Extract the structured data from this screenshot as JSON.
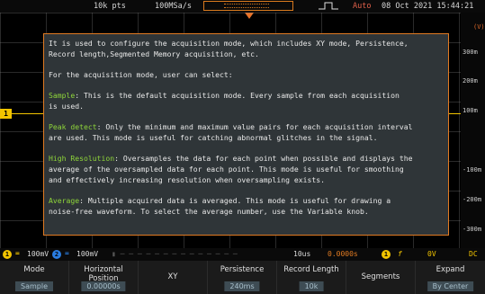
{
  "top_bar": {
    "record_length": "10k pts",
    "sample_rate": "100MSa/s",
    "trigger_mode": "Auto",
    "datetime": "08 Oct 2021 15:44:21"
  },
  "scale": {
    "unit": "(V)",
    "ticks": [
      "300m",
      "200m",
      "100m",
      "-100m",
      "-200m",
      "-300m"
    ]
  },
  "channel_marker": "1",
  "help": {
    "intro": "It is used to configure the acquisition mode, which includes XY mode, Persistence,\nRecord length,Segmented Memory acquisition, etc.",
    "select_line": "For the acquisition mode, user can select:",
    "items": [
      {
        "name": "Sample",
        "text": ": This is the default acquisition mode. Every sample from each acquisition\nis used."
      },
      {
        "name": "Peak detect",
        "text": ": Only the minimum and maximum value pairs for each acquisition interval\nare used. This mode is useful for catching abnormal glitches in the signal."
      },
      {
        "name": "High Resolution",
        "text": ": Oversamples the data for each point when possible and displays the\naverage of the oversampled data for each point. This mode is useful for smoothing\nand effectively increasing resolution when oversampling exists."
      },
      {
        "name": "Average",
        "text": ": Multiple acquired data is averaged. This mode is useful for drawing a\nnoise-free waveform. To select the average number, use the Variable knob."
      }
    ]
  },
  "readout": {
    "ch1_label": "1",
    "ch1_value": "100mV",
    "ch2_label": "2",
    "ch2_value": "100mV",
    "timebase": "10us",
    "position": "0.0000s",
    "trigger_source": "1",
    "trigger_slope": "f",
    "trigger_level": "0V",
    "coupling": "DC"
  },
  "softkeys": [
    {
      "label": "Mode",
      "value": "Sample"
    },
    {
      "label": "Horizontal\nPosition",
      "value": "0.00000s"
    },
    {
      "label": "XY",
      "value": ""
    },
    {
      "label": "Persistence",
      "value": "240ms"
    },
    {
      "label": "Record Length",
      "value": "10k"
    },
    {
      "label": "Segments",
      "value": ""
    },
    {
      "label": "Expand",
      "value": "By Center"
    }
  ],
  "colors": {
    "accent": "#e07a22",
    "ch1": "#f2c400",
    "ch2": "#2a7de1",
    "highlight": "#8fd63a"
  }
}
